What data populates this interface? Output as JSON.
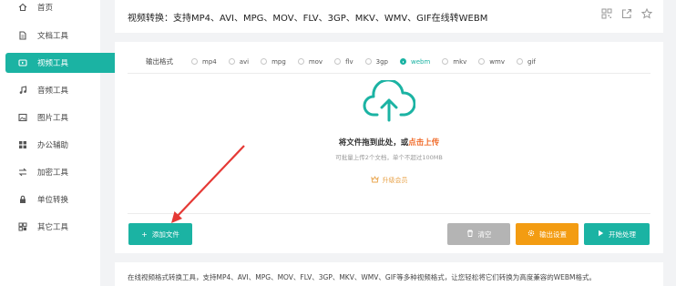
{
  "sidebar": {
    "items": [
      {
        "label": "首页",
        "icon": "home-icon"
      },
      {
        "label": "文档工具",
        "icon": "document-icon"
      },
      {
        "label": "视频工具",
        "icon": "video-icon",
        "active": true
      },
      {
        "label": "音频工具",
        "icon": "music-icon"
      },
      {
        "label": "图片工具",
        "icon": "image-icon"
      },
      {
        "label": "办公辅助",
        "icon": "apps-icon"
      },
      {
        "label": "加密工具",
        "icon": "swap-icon"
      },
      {
        "label": "单位转换",
        "icon": "lock-icon"
      },
      {
        "label": "其它工具",
        "icon": "grid-icon"
      }
    ],
    "active_color": "#1bb3a3"
  },
  "header": {
    "title": "视频转换：支持MP4、AVI、MPG、MOV、FLV、3GP、MKV、WMV、GIF在线转WEBM",
    "actions": [
      "qrcode-icon",
      "share-icon",
      "star-icon"
    ]
  },
  "converter": {
    "format_label": "输出格式",
    "formats": [
      "mp4",
      "avi",
      "mpg",
      "mov",
      "flv",
      "3gp",
      "webm",
      "mkv",
      "wmv",
      "gif"
    ],
    "selected_format": "webm",
    "drop_text_prefix": "将文件拖到此处，或",
    "drop_text_link": "点击上传",
    "hint": "可批量上传2个文档，单个不超过100MB",
    "vip_label": "升级会员",
    "buttons": {
      "add": "添加文件",
      "clear": "清空",
      "settings": "输出设置",
      "start": "开始处理"
    }
  },
  "description": "在线视频格式转换工具，支持MP4、AVI、MPG、MOV、FLV、3GP、MKV、WMV、GIF等多种视频格式，让您轻松将它们转换为高度兼容的WEBM格式。",
  "colors": {
    "accent": "#1bb3a3",
    "orange": "#f39c12",
    "link": "#f06a28",
    "arrow": "#e53935"
  }
}
